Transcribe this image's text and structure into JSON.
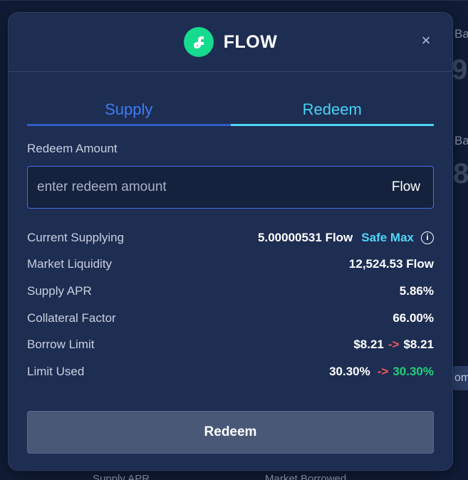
{
  "background": {
    "peek_top": "Ba",
    "peek_mid": "Ba",
    "big_top": "9",
    "big_mid": "8",
    "chip": "om",
    "bottom_left": "Supply APR",
    "bottom_right": "Market Borrowed"
  },
  "modal": {
    "title": "FLOW",
    "logo_icon": "flow-logo-icon",
    "close_label": "×",
    "tabs": [
      {
        "label": "Supply",
        "active": false
      },
      {
        "label": "Redeem",
        "active": true
      }
    ],
    "amount_label": "Redeem Amount",
    "amount_placeholder": "enter redeem amount",
    "amount_value": "",
    "amount_unit": "Flow",
    "rows": {
      "current_supplying": {
        "label": "Current Supplying",
        "value": "5.00000531 Flow",
        "action": "Safe Max"
      },
      "market_liquidity": {
        "label": "Market Liquidity",
        "value": "12,524.53 Flow"
      },
      "supply_apr": {
        "label": "Supply APR",
        "value": "5.86%"
      },
      "collateral_factor": {
        "label": "Collateral Factor",
        "value": "66.00%"
      },
      "borrow_limit": {
        "label": "Borrow Limit",
        "from": "$8.21",
        "arrow": "->",
        "to": "$8.21"
      },
      "limit_used": {
        "label": "Limit Used",
        "from": "30.30%",
        "arrow": "->",
        "to": "30.30%"
      }
    },
    "submit_label": "Redeem"
  },
  "colors": {
    "modal_bg": "#1e2d52",
    "accent_blue": "#3d7cf5",
    "accent_cyan": "#4fd6f8",
    "flow_green": "#16db8f",
    "arrow_red": "#ee5b5b",
    "positive_green": "#23d07a"
  }
}
